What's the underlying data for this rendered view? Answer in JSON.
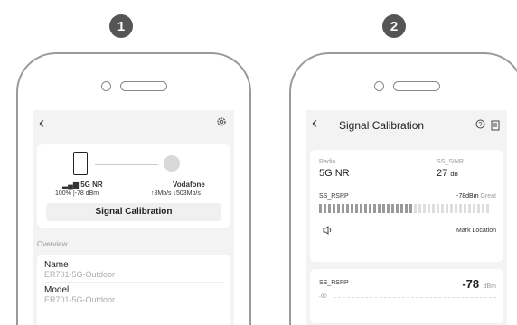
{
  "steps": [
    "1",
    "2"
  ],
  "phone1": {
    "back_icon": "chevron-left-icon",
    "settings_icon": "gear-icon",
    "device_signal": "5G NR",
    "device_stats": "100% |-78 dBm",
    "carrier_name": "Vodafone",
    "carrier_speeds": "↑8Mb/s ↓503Mb/s",
    "calibrate_button": "Signal Calibration",
    "section_title": "Overview",
    "fields": [
      {
        "label": "Name",
        "value": "ER701-5G-Outdoor"
      },
      {
        "label": "Model",
        "value": "ER701-5G-Outdoor"
      }
    ]
  },
  "phone2": {
    "back_icon": "chevron-left-icon",
    "title": "Signal Calibration",
    "help_icon": "question-circle-icon",
    "doc_icon": "document-icon",
    "radio_label": "Radio",
    "radio_value": "5G NR",
    "sinr_label": "SS_SINR",
    "sinr_value": "27",
    "sinr_unit": "dB",
    "rsrp_label": "SS_RSRP",
    "rsrp_reading": "-78dBm",
    "rsrp_quality": "Great",
    "bar_level": 0.55,
    "speaker_icon": "speaker-icon",
    "mark_location": "Mark Location",
    "rsrp2_label": "SS_RSRP",
    "rsrp2_value": "-78",
    "rsrp2_unit": "dBm",
    "axis_tick": "-90"
  }
}
